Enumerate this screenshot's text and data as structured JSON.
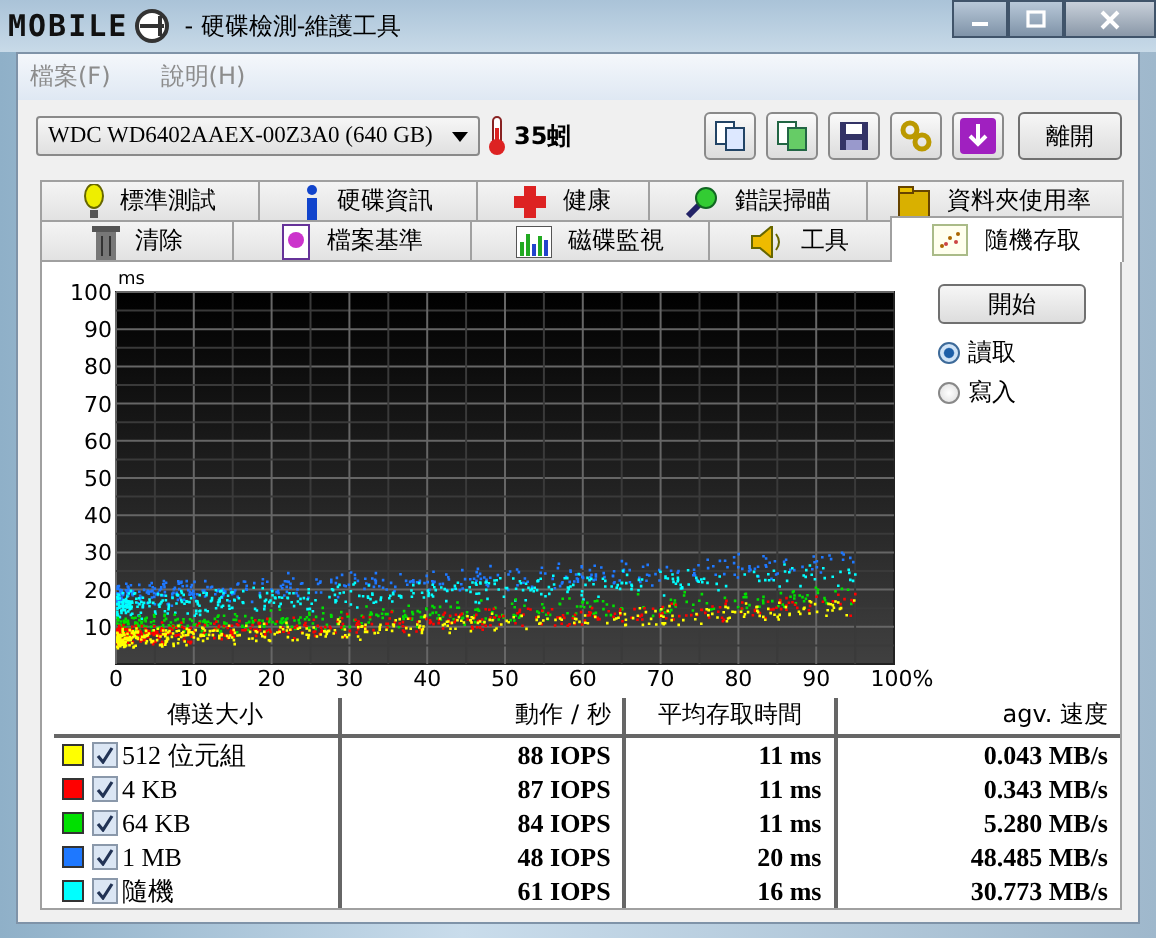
{
  "window": {
    "logo_text": "MOBILE",
    "title": "- 硬碟檢測-維護工具"
  },
  "menu": [
    {
      "label": "檔案(F)",
      "disabled": true
    },
    {
      "label": "說明(H)",
      "disabled": true
    }
  ],
  "toolbar": {
    "drive": "WDC WD6402AAEX-00Z3A0 (640 GB)",
    "temperature": "35蚓",
    "exit_button": "離開"
  },
  "tabs_row_1": [
    {
      "label": "標準測試",
      "selected": false
    },
    {
      "label": "硬碟資訊",
      "selected": false
    },
    {
      "label": "健康",
      "selected": false
    },
    {
      "label": "錯誤掃瞄",
      "selected": false
    },
    {
      "label": "資料夾使用率",
      "selected": false
    }
  ],
  "tabs_row_2": [
    {
      "label": "清除",
      "selected": false
    },
    {
      "label": "檔案基準",
      "selected": false
    },
    {
      "label": "磁碟監視",
      "selected": false
    },
    {
      "label": "工具",
      "selected": false
    },
    {
      "label": "隨機存取",
      "selected": true
    }
  ],
  "chart": {
    "unit": "ms",
    "y_labels": [
      "100",
      "90",
      "80",
      "70",
      "60",
      "50",
      "40",
      "30",
      "20",
      "10"
    ],
    "x_labels": [
      "0",
      "10",
      "20",
      "30",
      "40",
      "50",
      "60",
      "70",
      "80",
      "90",
      "100%"
    ]
  },
  "start_button": "開始",
  "modes": [
    {
      "label": "讀取",
      "selected": true
    },
    {
      "label": "寫入",
      "selected": false
    }
  ],
  "table": {
    "columns": [
      "傳送大小",
      "動作 / 秒",
      "平均存取時間",
      "agv. 速度"
    ],
    "rows": [
      {
        "color": "#ffff00",
        "checked": true,
        "size": "512 位元組",
        "iops": "88 IOPS",
        "access_time": "11 ms",
        "speed": "0.043 MB/s"
      },
      {
        "color": "#ff0000",
        "checked": true,
        "size": "4 KB",
        "iops": "87 IOPS",
        "access_time": "11 ms",
        "speed": "0.343 MB/s"
      },
      {
        "color": "#00e000",
        "checked": true,
        "size": "64 KB",
        "iops": "84 IOPS",
        "access_time": "11 ms",
        "speed": "5.280 MB/s"
      },
      {
        "color": "#1e78ff",
        "checked": true,
        "size": "1 MB",
        "iops": "48 IOPS",
        "access_time": "20 ms",
        "speed": "48.485 MB/s"
      },
      {
        "color": "#00ffff",
        "checked": true,
        "size": "隨機",
        "iops": "61 IOPS",
        "access_time": "16 ms",
        "speed": "30.773 MB/s"
      }
    ]
  }
}
